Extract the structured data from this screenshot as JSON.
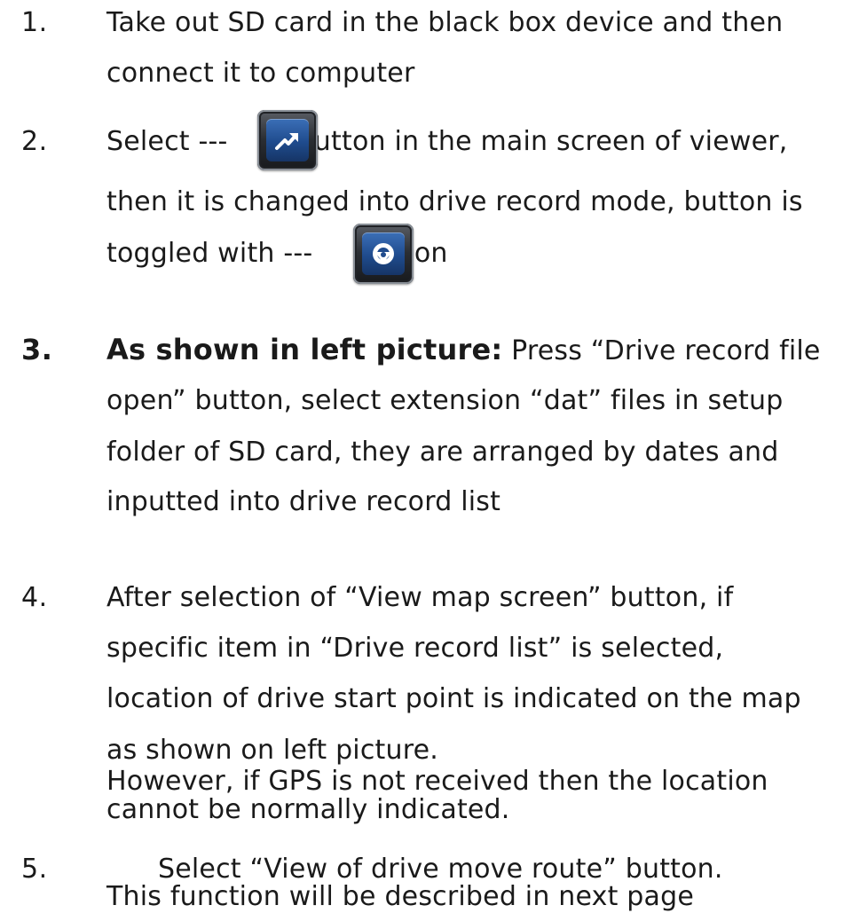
{
  "steps": [
    {
      "number": "1.",
      "lines": [
        "Take out SD card in the black box device and then",
        "connect it to computer"
      ]
    },
    {
      "number": "2.",
      "line1_pre": "Select ---",
      "line1_post": "button in the main screen of viewer,",
      "line2": "then it is changed into drive record mode, button is",
      "line3_pre": "toggled with ---",
      "line3_post": "button",
      "icon_a": "drive-record-mode-icon",
      "icon_b": "steering-wheel-icon"
    },
    {
      "number": "3.",
      "lead": "As shown in left picture:",
      "line1_rest": " Press “Drive record file",
      "lines": [
        "open” button, select extension “dat” files in setup",
        "folder of SD card, they are arranged by dates and",
        "inputted into drive record list"
      ]
    },
    {
      "number": "4.",
      "lines": [
        "After selection of “View map screen” button, if",
        "specific item in “Drive record list” is selected,",
        "location of drive start point is indicated on the map",
        "as shown on left picture.",
        "However, if GPS is not received then the location",
        "cannot be normally indicated."
      ]
    },
    {
      "number": "5.",
      "lines": [
        "Select “View of drive move route” button.",
        "This function will be described in next page"
      ]
    }
  ]
}
